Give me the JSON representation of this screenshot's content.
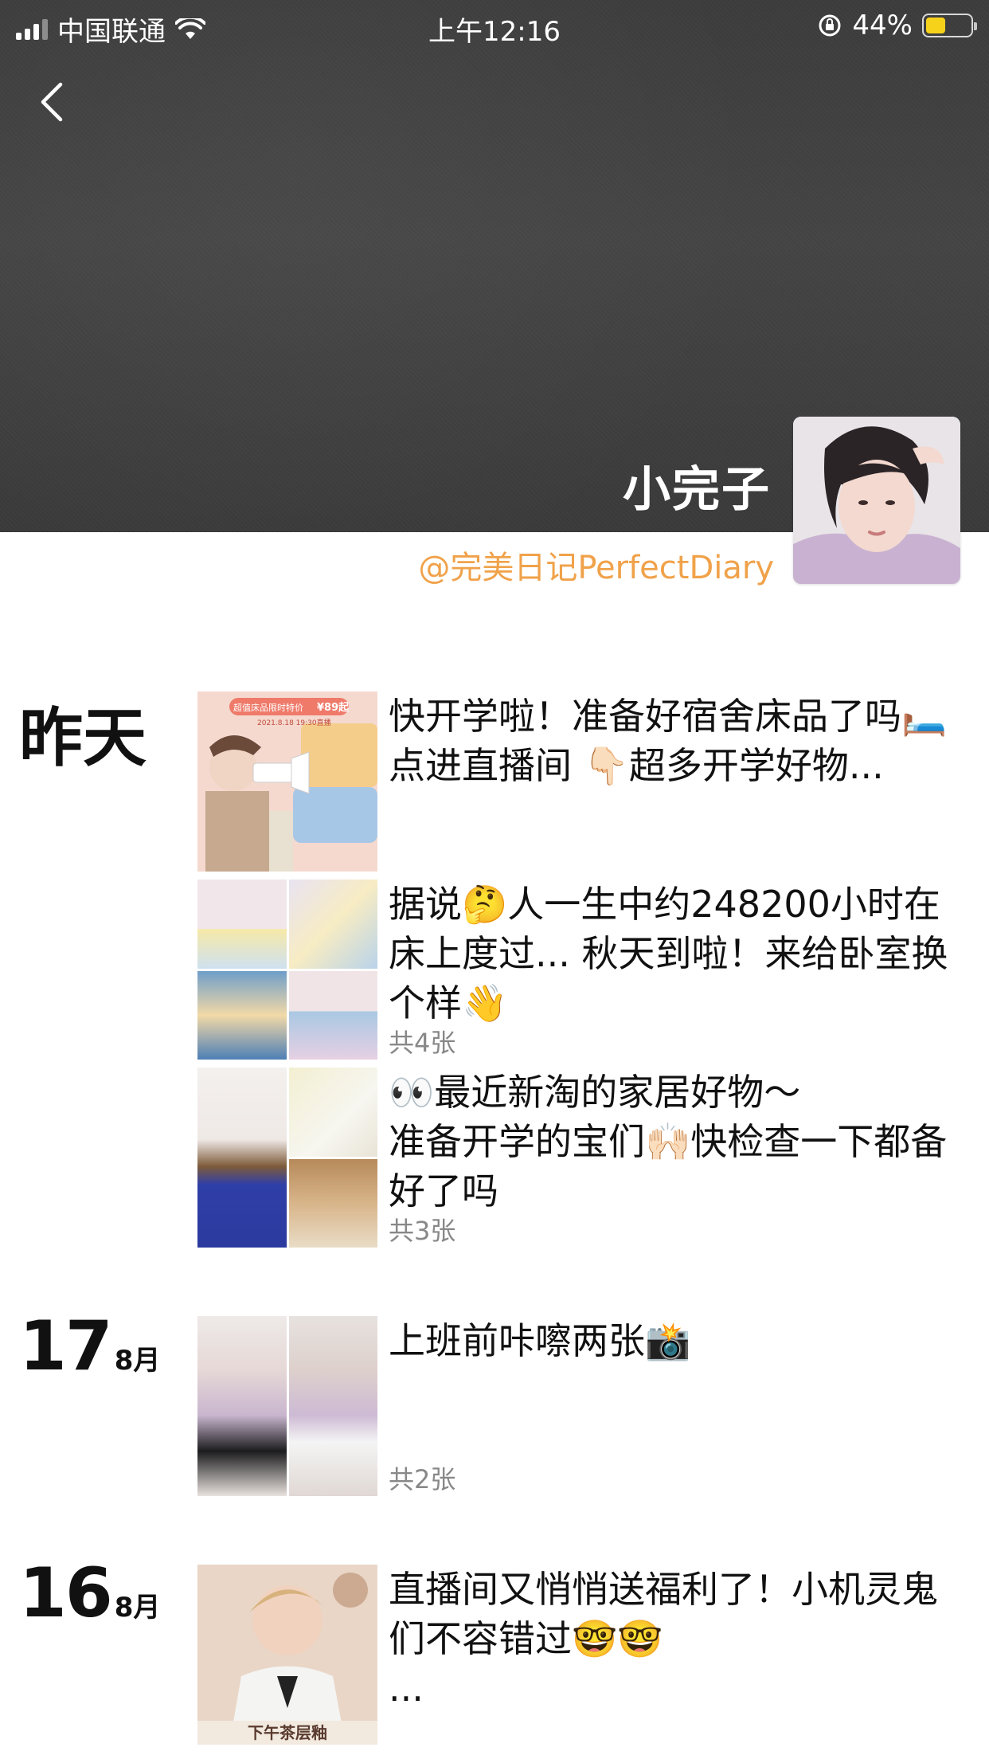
{
  "status_bar": {
    "carrier": "中国联通",
    "time": "上午12:16",
    "battery_percent": "44%",
    "battery_level": 0.44
  },
  "profile": {
    "name": "小完子",
    "signature": "@完美日记PerfectDiary"
  },
  "feed": [
    {
      "date_label": "昨天",
      "posts": [
        {
          "text": "快开学啦！准备好宿舍床品了吗🛏️\n点进直播间 👇🏻超多开学好物...",
          "count": "",
          "promo_badge": "超值床品限时特价",
          "promo_price": "¥89起",
          "promo_date": "2021.8.18 19:30直播"
        },
        {
          "text": "据说🤔人一生中约248200小时在床上度过... 秋天到啦！来给卧室换个样👋",
          "count": "共4张"
        },
        {
          "text": "👀最近新淘的家居好物～\n准备开学的宝们🙌🏻快检查一下都备好了吗",
          "count": "共3张"
        }
      ]
    },
    {
      "date_day": "17",
      "date_month": "8月",
      "posts": [
        {
          "text": "上班前咔嚓两张📸",
          "count": "共2张"
        }
      ]
    },
    {
      "date_day": "16",
      "date_month": "8月",
      "posts": [
        {
          "text": "直播间又悄悄送福利了！小机灵鬼们不容错过🤓🤓\n...",
          "count": "",
          "poster_text": "下午茶层釉"
        }
      ]
    }
  ]
}
